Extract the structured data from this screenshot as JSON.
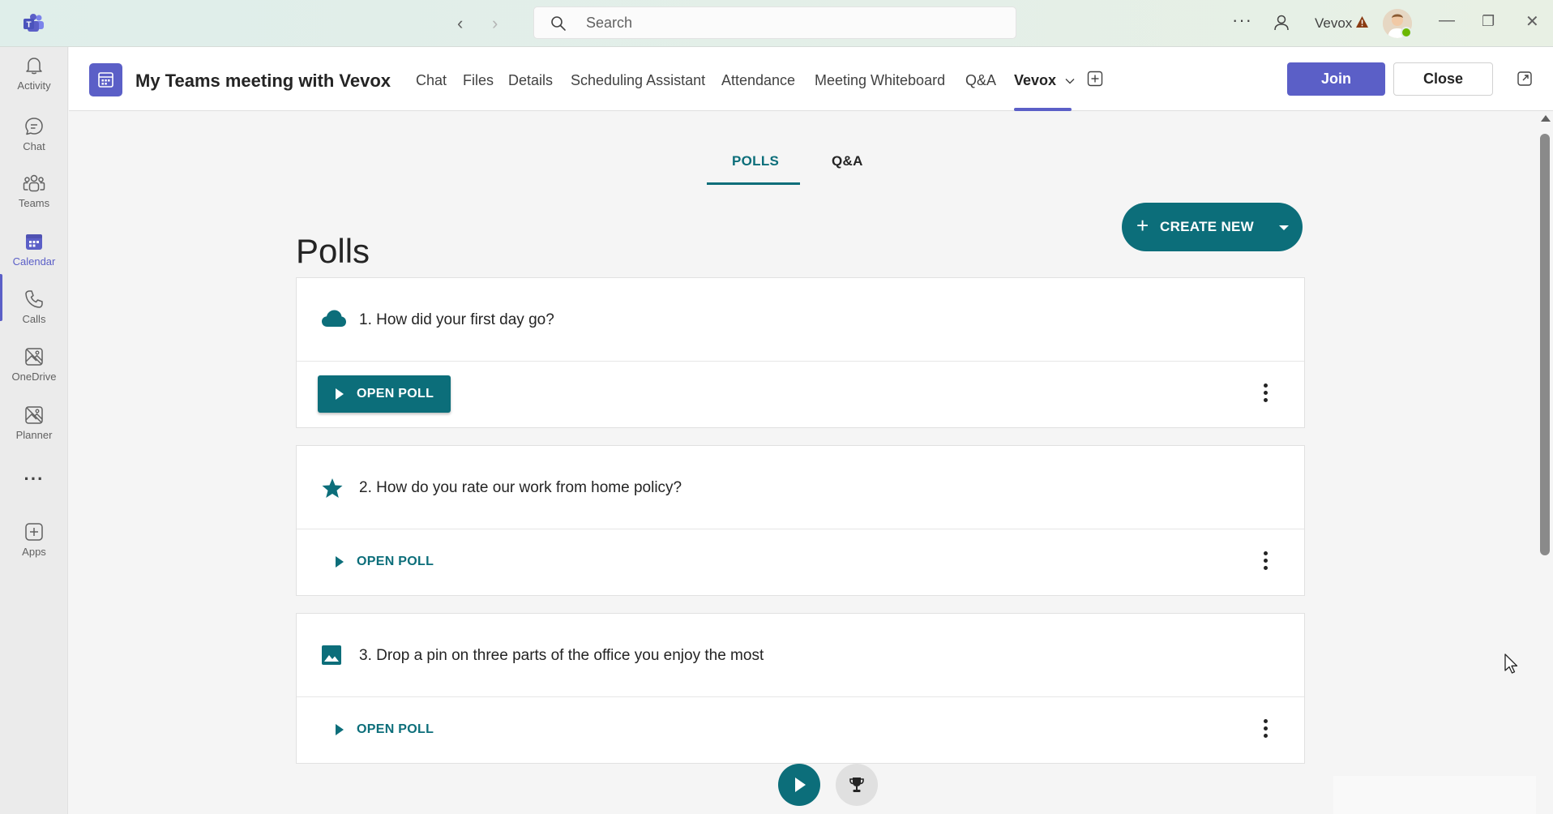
{
  "titlebar": {
    "search_placeholder": "Search",
    "user_name": "Vevox",
    "more_label": "···"
  },
  "rail": {
    "items": [
      {
        "label": "Activity",
        "icon": "bell-icon"
      },
      {
        "label": "Chat",
        "icon": "chat-icon"
      },
      {
        "label": "Teams",
        "icon": "teams-icon"
      },
      {
        "label": "Calendar",
        "icon": "calendar-icon",
        "active": true
      },
      {
        "label": "Calls",
        "icon": "phone-icon"
      },
      {
        "label": "OneDrive",
        "icon": "onedrive-icon"
      },
      {
        "label": "Planner",
        "icon": "planner-icon"
      },
      {
        "label": "···",
        "icon": "more-icon"
      },
      {
        "label": "Apps",
        "icon": "apps-icon"
      }
    ]
  },
  "meeting": {
    "title": "My Teams meeting with Vevox",
    "tabs": [
      "Chat",
      "Files",
      "Details",
      "Scheduling Assistant",
      "Attendance",
      "Meeting Whiteboard",
      "Q&A",
      "Vevox"
    ],
    "active_tab": "Vevox",
    "join_label": "Join",
    "close_label": "Close"
  },
  "vevox": {
    "tabs": [
      "POLLS",
      "Q&A"
    ],
    "active_tab": "POLLS",
    "heading": "Polls",
    "create_label": "CREATE NEW",
    "polls": [
      {
        "title": "1. How did your first day go?",
        "icon": "cloud-icon",
        "action": "OPEN POLL",
        "style": "filled"
      },
      {
        "title": "2. How do you rate our work from home policy?",
        "icon": "star-icon",
        "action": "OPEN POLL",
        "style": "text"
      },
      {
        "title": "3. Drop a pin on three parts of the office you enjoy the most",
        "icon": "image-icon",
        "action": "OPEN POLL",
        "style": "text"
      }
    ]
  },
  "colors": {
    "teams_purple": "#5b5fc7",
    "vevox_teal": "#0c6e7a"
  }
}
